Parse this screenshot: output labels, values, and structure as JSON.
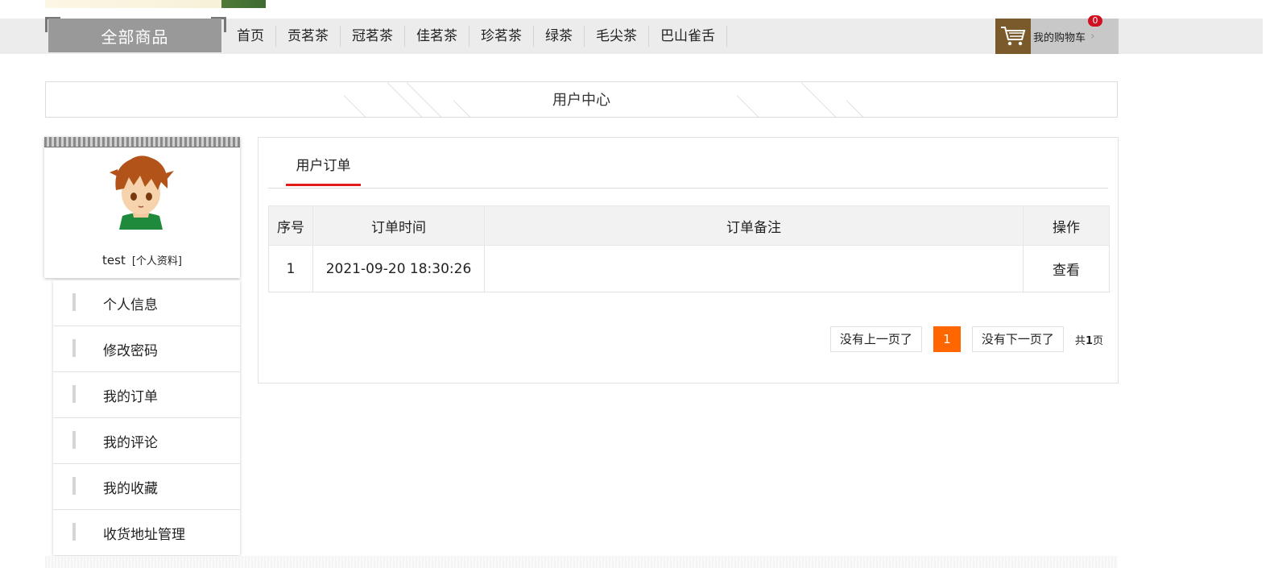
{
  "nav": {
    "all_goods": "全部商品",
    "items": [
      "首页",
      "贡茗茶",
      "冠茗茶",
      "佳茗茶",
      "珍茗茶",
      "绿茶",
      "毛尖茶",
      "巴山雀舌"
    ],
    "cart_label": "我的购物车",
    "cart_count": "0",
    "cart_icon": "shopping-cart-icon"
  },
  "page_title": "用户中心",
  "profile": {
    "username": "test",
    "profile_link": "[个人资料]"
  },
  "side_menu": [
    "个人信息",
    "修改密码",
    "我的订单",
    "我的评论",
    "我的收藏",
    "收货地址管理"
  ],
  "tab": "用户订单",
  "table": {
    "headers": [
      "序号",
      "订单时间",
      "订单备注",
      "操作"
    ],
    "rows": [
      {
        "index": "1",
        "time": "2021-09-20 18:30:26",
        "note": "",
        "action": "查看"
      }
    ]
  },
  "pager": {
    "prev": "没有上一页了",
    "current": "1",
    "next": "没有下一页了",
    "total_prefix": "共",
    "total_pages": "1",
    "total_suffix": "页"
  },
  "colors": {
    "accent": "#ff6600",
    "tab_underline": "#e31b1b",
    "cart_icon_bg": "#7a5a2a",
    "badge": "#d01020"
  }
}
